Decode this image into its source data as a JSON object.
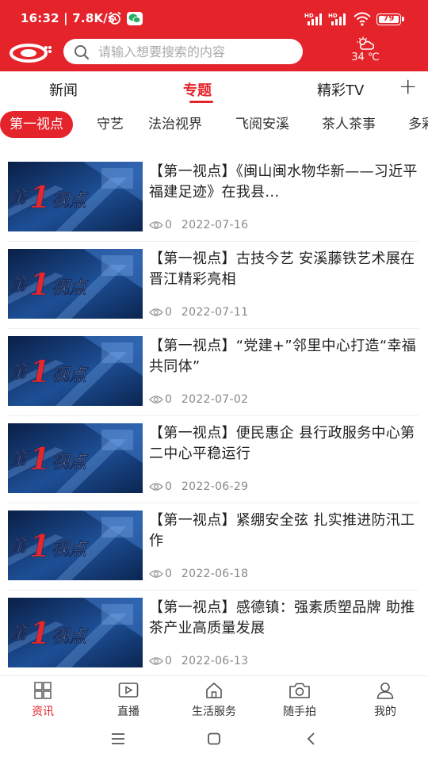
{
  "status_bar": {
    "time": "16:32",
    "net_speed": "7.8K/s",
    "battery": "79",
    "icons": [
      "alarm-icon",
      "wechat-icon",
      "signal-hd-icon",
      "signal-hd-icon",
      "wifi-icon",
      "battery-icon"
    ]
  },
  "header": {
    "search_placeholder": "请输入想要搜索的内容",
    "weather_temp": "34 ℃",
    "brand_color": "#e5232b"
  },
  "tabs": [
    {
      "label": "新闻",
      "active": false
    },
    {
      "label": "专题",
      "active": true
    },
    {
      "label": "精彩TV",
      "active": false
    }
  ],
  "subcategories": [
    {
      "label": "第一视点",
      "active": true
    },
    {
      "label": "守艺",
      "active": false
    },
    {
      "label": "法治视界",
      "active": false
    },
    {
      "label": "飞阅安溪",
      "active": false
    },
    {
      "label": "茶人茶事",
      "active": false
    },
    {
      "label": "多彩",
      "active": false
    }
  ],
  "thumb_text": {
    "a": "第",
    "b": "1",
    "c": "视点"
  },
  "articles": [
    {
      "title": "【第一视点】《闽山闽水物华新——习近平福建足迹》在我县...",
      "views": "0",
      "date": "2022-07-16"
    },
    {
      "title": "【第一视点】古技今艺 安溪藤铁艺术展在晋江精彩亮相",
      "views": "0",
      "date": "2022-07-11"
    },
    {
      "title": "【第一视点】“党建+”邻里中心打造“幸福共同体”",
      "views": "0",
      "date": "2022-07-02"
    },
    {
      "title": "【第一视点】便民惠企 县行政服务中心第二中心平稳运行",
      "views": "0",
      "date": "2022-06-29"
    },
    {
      "title": "【第一视点】紧绷安全弦 扎实推进防汛工作",
      "views": "0",
      "date": "2022-06-18"
    },
    {
      "title": "【第一视点】感德镇：强素质塑品牌 助推茶产业高质量发展",
      "views": "0",
      "date": "2022-06-13"
    }
  ],
  "bottom_nav": [
    {
      "label": "资讯",
      "icon": "news-grid-icon",
      "active": true
    },
    {
      "label": "直播",
      "icon": "live-play-icon",
      "active": false
    },
    {
      "label": "生活服务",
      "icon": "home-icon",
      "active": false
    },
    {
      "label": "随手拍",
      "icon": "camera-icon",
      "active": false
    },
    {
      "label": "我的",
      "icon": "user-icon",
      "active": false
    }
  ]
}
